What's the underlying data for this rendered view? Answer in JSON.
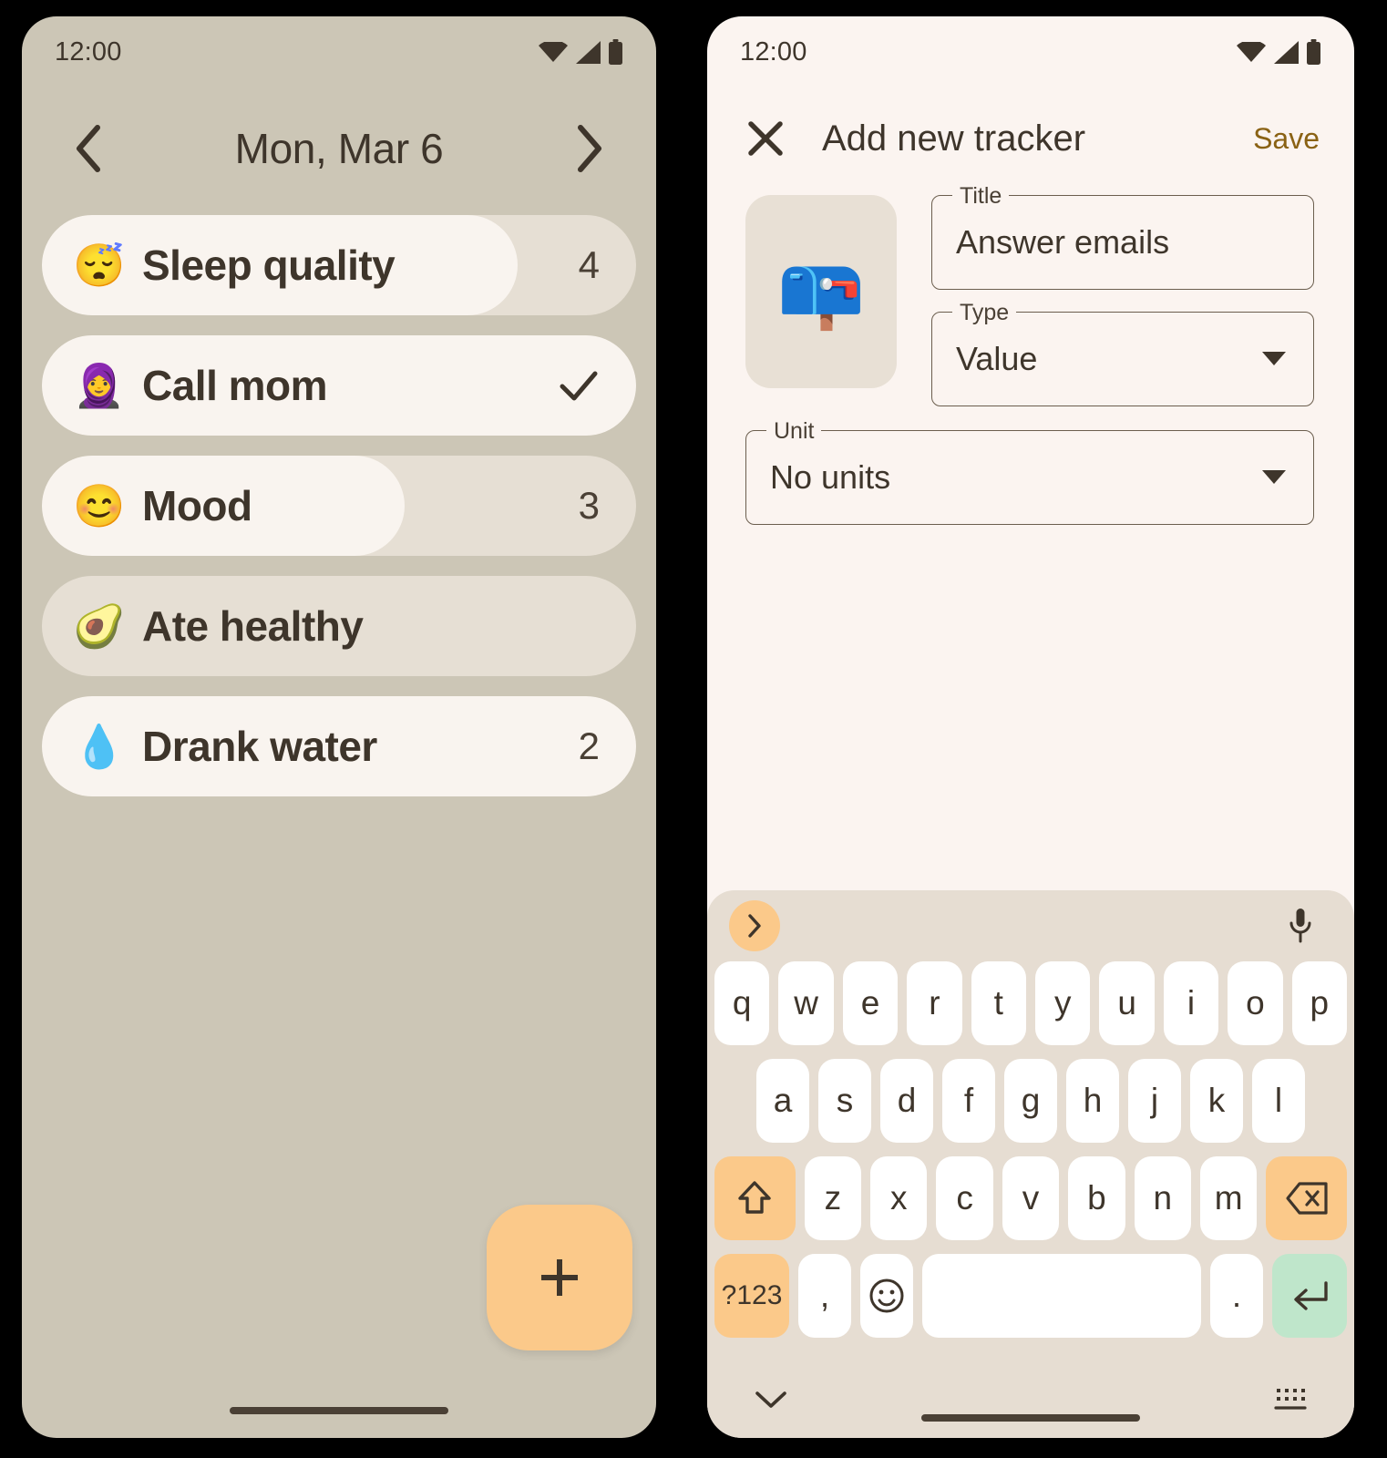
{
  "left_phone": {
    "status_bar": {
      "time": "12:00",
      "icons": [
        "wifi-icon",
        "cellular-icon",
        "battery-icon"
      ]
    },
    "date_header": {
      "prev_label": "chevron-left-icon",
      "title": "Mon, Mar 6",
      "next_label": "chevron-right-icon"
    },
    "trackers": [
      {
        "emoji": "😴",
        "emoji_name": "sleeping-face-emoji",
        "label": "Sleep quality",
        "value": "4",
        "display": "value",
        "progress_pct": 80
      },
      {
        "emoji": "🧕",
        "emoji_name": "woman-with-headscarf-emoji",
        "label": "Call mom",
        "value": "",
        "display": "check",
        "progress_pct": 100
      },
      {
        "emoji": "😊",
        "emoji_name": "smiling-face-emoji",
        "label": "Mood",
        "value": "3",
        "display": "value",
        "progress_pct": 61
      },
      {
        "emoji": "🥑",
        "emoji_name": "avocado-emoji",
        "label": "Ate healthy",
        "value": "",
        "display": "none",
        "progress_pct": 0
      },
      {
        "emoji": "💧",
        "emoji_name": "droplet-emoji",
        "label": "Drank water",
        "value": "2",
        "display": "value",
        "progress_pct": 100
      }
    ],
    "fab": {
      "label": "plus-icon"
    }
  },
  "right_phone": {
    "status_bar": {
      "time": "12:00",
      "icons": [
        "wifi-icon",
        "cellular-icon",
        "battery-icon"
      ]
    },
    "appbar": {
      "close_label": "close-icon",
      "title": "Add new tracker",
      "save_label": "Save"
    },
    "form": {
      "emoji": "📪",
      "emoji_name": "closed-mailbox-with-raised-flag-emoji",
      "fields": [
        {
          "label": "Title",
          "value": "Answer emails",
          "kind": "text"
        },
        {
          "label": "Type",
          "value": "Value",
          "kind": "select"
        },
        {
          "label": "Unit",
          "value": "No units",
          "kind": "select"
        }
      ]
    },
    "keyboard": {
      "suggestion_bar": {
        "expand_icon": "chevron-right-icon",
        "mic_icon": "microphone-icon"
      },
      "row1": [
        "q",
        "w",
        "e",
        "r",
        "t",
        "y",
        "u",
        "i",
        "o",
        "p"
      ],
      "row2": [
        "a",
        "s",
        "d",
        "f",
        "g",
        "h",
        "j",
        "k",
        "l"
      ],
      "row3_shift": "shift-icon",
      "row3": [
        "z",
        "x",
        "c",
        "v",
        "b",
        "n",
        "m"
      ],
      "row3_backspace": "backspace-icon",
      "row4_symbols": "?123",
      "row4_comma": ",",
      "row4_emoji": "emoji-icon",
      "row4_space": "",
      "row4_period": ".",
      "row4_enter": "enter-icon",
      "bottom": {
        "hide_icon": "chevron-down-icon",
        "switch_icon": "keyboard-switch-icon"
      }
    }
  },
  "colors": {
    "left_background": "#CCC6B6",
    "right_background": "#FBF4F0",
    "track_unfilled": "#E6DFD4",
    "track_filled": "#F9F4EF",
    "accent_amber": "#FBC98A",
    "save_gold": "#8A6214",
    "enter_green": "#BFE6CB",
    "text_dark": "#3E352B",
    "keyboard_background": "#E6DDD2"
  }
}
